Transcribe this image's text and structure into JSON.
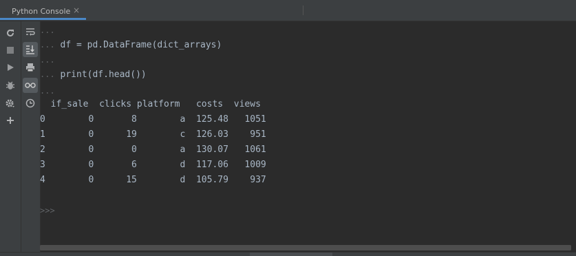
{
  "tab": {
    "title": "Python Console",
    "close": "×"
  },
  "console": {
    "prompt_dots": "...",
    "lines": [
      {
        "dots": "...",
        "code": ""
      },
      {
        "dots": "...",
        "code": " df = pd.DataFrame(dict_arrays)"
      },
      {
        "dots": "...",
        "code": ""
      },
      {
        "dots": "...",
        "code": " print(df.head())"
      },
      {
        "dots": "...",
        "code": ""
      }
    ],
    "table": {
      "header": "  if_sale  clicks platform   costs  views",
      "rows": [
        "0        0       8        a  125.48   1051",
        "1        0      19        c  126.03    951",
        "2        0       0        a  130.07   1061",
        "3        0       6        d  117.06   1009",
        "4        0      15        d  105.79    937"
      ]
    },
    "prompt": ">>>"
  },
  "toolbar": {
    "left": [
      "rerun-icon",
      "stop-icon",
      "run-icon",
      "debug-icon",
      "settings-icon",
      "add-icon"
    ],
    "right": [
      "soft-wrap-icon",
      "scroll-to-end-icon",
      "print-icon",
      "show-variables-icon",
      "history-icon"
    ]
  },
  "colors": {
    "background": "#2b2b2b",
    "text": "#a9b7c6",
    "muted": "#606366",
    "accent": "#4a88c7"
  }
}
